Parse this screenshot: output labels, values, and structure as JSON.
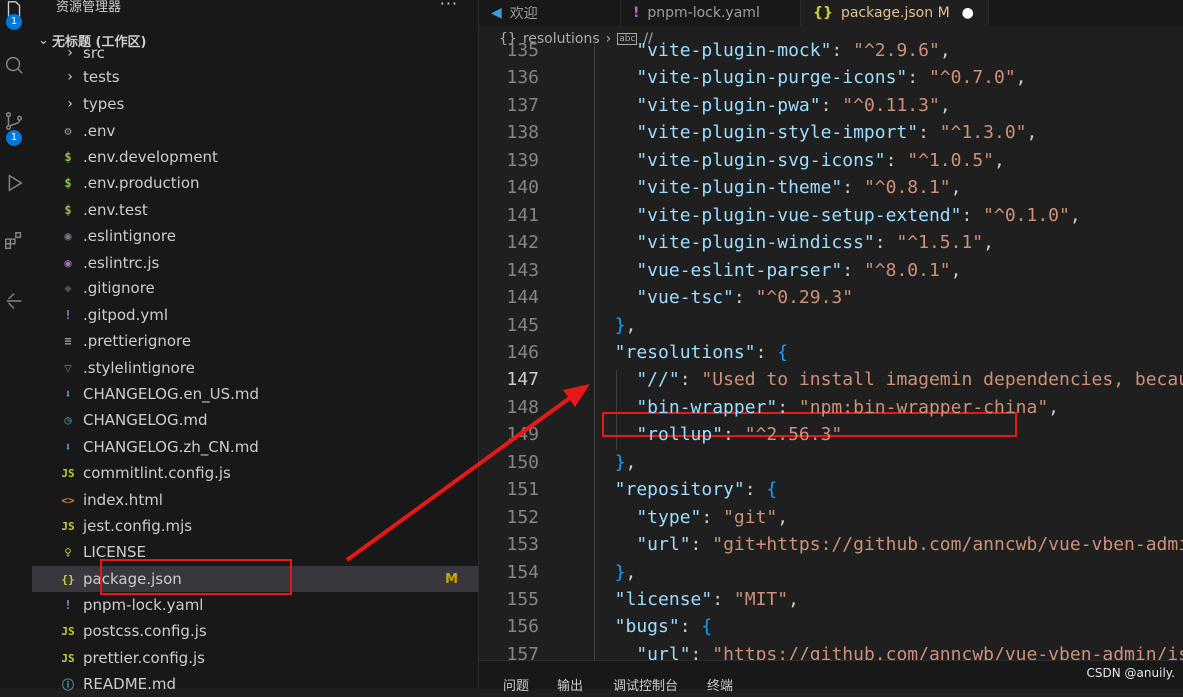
{
  "sidebar": {
    "title": "资源管理器",
    "more": "···",
    "workspace": "无标题 (工作区)"
  },
  "activity_badges": {
    "explorer": "1",
    "scm": "1"
  },
  "tree": [
    {
      "label": "src",
      "icon": "chevron-right-icon",
      "glyph": "›",
      "color": "#cccccc",
      "folder": true
    },
    {
      "label": "tests",
      "icon": "chevron-right-icon",
      "glyph": "›",
      "color": "#cccccc",
      "folder": true
    },
    {
      "label": "types",
      "icon": "chevron-right-icon",
      "glyph": "›",
      "color": "#cccccc",
      "folder": true
    },
    {
      "label": ".env",
      "icon": "gear-icon",
      "glyph": "⚙",
      "color": "#8b9bab"
    },
    {
      "label": ".env.development",
      "icon": "dollar-icon",
      "glyph": "$",
      "color": "#8dc149"
    },
    {
      "label": ".env.production",
      "icon": "dollar-icon",
      "glyph": "$",
      "color": "#8dc149"
    },
    {
      "label": ".env.test",
      "icon": "dollar-icon",
      "glyph": "$",
      "color": "#8dc149"
    },
    {
      "label": ".eslintignore",
      "icon": "eslint-icon",
      "glyph": "◉",
      "color": "#6d8086"
    },
    {
      "label": ".eslintrc.js",
      "icon": "eslint-icon",
      "glyph": "◉",
      "color": "#a074c4"
    },
    {
      "label": ".gitignore",
      "icon": "git-icon",
      "glyph": "◆",
      "color": "#41535b"
    },
    {
      "label": ".gitpod.yml",
      "icon": "exclamation-icon",
      "glyph": "!",
      "color": "#a074c4"
    },
    {
      "label": ".prettierignore",
      "icon": "lines-icon",
      "glyph": "≡",
      "color": "#8b9bab"
    },
    {
      "label": ".stylelintignore",
      "icon": "stylelint-icon",
      "glyph": "▽",
      "color": "#6d8086"
    },
    {
      "label": "CHANGELOG.en_US.md",
      "icon": "download-icon",
      "glyph": "⬇",
      "color": "#519aba"
    },
    {
      "label": "CHANGELOG.md",
      "icon": "clock-icon",
      "glyph": "◷",
      "color": "#519aba"
    },
    {
      "label": "CHANGELOG.zh_CN.md",
      "icon": "download-icon",
      "glyph": "⬇",
      "color": "#519aba"
    },
    {
      "label": "commitlint.config.js",
      "icon": "js-icon",
      "glyph": "JS",
      "color": "#cbcb41"
    },
    {
      "label": "index.html",
      "icon": "html-icon",
      "glyph": "<>",
      "color": "#e37933"
    },
    {
      "label": "jest.config.mjs",
      "icon": "js-icon",
      "glyph": "JS",
      "color": "#cbcb41"
    },
    {
      "label": "LICENSE",
      "icon": "license-icon",
      "glyph": "♀",
      "color": "#cbcb41"
    },
    {
      "label": "package.json",
      "icon": "json-icon",
      "glyph": "{}",
      "color": "#cbcb41",
      "selected": true,
      "badge": "M"
    },
    {
      "label": "pnpm-lock.yaml",
      "icon": "exclamation-icon",
      "glyph": "!",
      "color": "#a074c4"
    },
    {
      "label": "postcss.config.js",
      "icon": "js-icon",
      "glyph": "JS",
      "color": "#cbcb41"
    },
    {
      "label": "prettier.config.js",
      "icon": "js-icon",
      "glyph": "JS",
      "color": "#cbcb41"
    },
    {
      "label": "README.md",
      "icon": "info-icon",
      "glyph": "ⓘ",
      "color": "#519aba"
    }
  ],
  "tabs": [
    {
      "label": "欢迎",
      "icon": "vscode-icon",
      "glyph": "◀",
      "color": "#3e9ad6",
      "active": false
    },
    {
      "label": "pnpm-lock.yaml",
      "icon": "exclamation-icon",
      "glyph": "!",
      "color": "#a074c4",
      "active": false
    },
    {
      "label": "package.json M",
      "icon": "json-icon",
      "glyph": "{}",
      "color": "#cbcb41",
      "active": true,
      "dot": "●"
    }
  ],
  "breadcrumb": {
    "icon": "{}",
    "item1": "resolutions",
    "sep": "›",
    "icon2": "abc",
    "item2": "//"
  },
  "code_lines": [
    {
      "n": "135",
      "parts": [
        [
          "k",
          "    \"vite-plugin-mock\""
        ],
        [
          "p",
          ": "
        ],
        [
          "s",
          "\"^2.9.6\""
        ],
        [
          "p",
          ","
        ]
      ]
    },
    {
      "n": "136",
      "parts": [
        [
          "k",
          "    \"vite-plugin-purge-icons\""
        ],
        [
          "p",
          ": "
        ],
        [
          "s",
          "\"^0.7.0\""
        ],
        [
          "p",
          ","
        ]
      ]
    },
    {
      "n": "137",
      "parts": [
        [
          "k",
          "    \"vite-plugin-pwa\""
        ],
        [
          "p",
          ": "
        ],
        [
          "s",
          "\"^0.11.3\""
        ],
        [
          "p",
          ","
        ]
      ]
    },
    {
      "n": "138",
      "parts": [
        [
          "k",
          "    \"vite-plugin-style-import\""
        ],
        [
          "p",
          ": "
        ],
        [
          "s",
          "\"^1.3.0\""
        ],
        [
          "p",
          ","
        ]
      ]
    },
    {
      "n": "139",
      "parts": [
        [
          "k",
          "    \"vite-plugin-svg-icons\""
        ],
        [
          "p",
          ": "
        ],
        [
          "s",
          "\"^1.0.5\""
        ],
        [
          "p",
          ","
        ]
      ]
    },
    {
      "n": "140",
      "parts": [
        [
          "k",
          "    \"vite-plugin-theme\""
        ],
        [
          "p",
          ": "
        ],
        [
          "s",
          "\"^0.8.1\""
        ],
        [
          "p",
          ","
        ]
      ]
    },
    {
      "n": "141",
      "parts": [
        [
          "k",
          "    \"vite-plugin-vue-setup-extend\""
        ],
        [
          "p",
          ": "
        ],
        [
          "s",
          "\"^0.1.0\""
        ],
        [
          "p",
          ","
        ]
      ]
    },
    {
      "n": "142",
      "parts": [
        [
          "k",
          "    \"vite-plugin-windicss\""
        ],
        [
          "p",
          ": "
        ],
        [
          "s",
          "\"^1.5.1\""
        ],
        [
          "p",
          ","
        ]
      ]
    },
    {
      "n": "143",
      "parts": [
        [
          "k",
          "    \"vue-eslint-parser\""
        ],
        [
          "p",
          ": "
        ],
        [
          "s",
          "\"^8.0.1\""
        ],
        [
          "p",
          ","
        ]
      ]
    },
    {
      "n": "144",
      "parts": [
        [
          "k",
          "    \"vue-tsc\""
        ],
        [
          "p",
          ": "
        ],
        [
          "s",
          "\"^0.29.3\""
        ]
      ]
    },
    {
      "n": "145",
      "parts": [
        [
          "p",
          "  "
        ],
        [
          "b2",
          "}"
        ],
        [
          "p",
          ","
        ]
      ]
    },
    {
      "n": "146",
      "parts": [
        [
          "k",
          "  \"resolutions\""
        ],
        [
          "p",
          ": "
        ],
        [
          "b2",
          "{"
        ]
      ]
    },
    {
      "n": "147",
      "parts": [
        [
          "k",
          "    \"//\""
        ],
        [
          "p",
          ": "
        ],
        [
          "s",
          "\"Used to install imagemin dependencies, becau"
        ]
      ],
      "current": true
    },
    {
      "n": "148",
      "parts": [
        [
          "k",
          "    \"bin-wrapper\""
        ],
        [
          "p",
          ": "
        ],
        [
          "s",
          "\"npm:bin-wrapper-china\""
        ],
        [
          "p",
          ","
        ]
      ]
    },
    {
      "n": "149",
      "parts": [
        [
          "k",
          "    \"rollup\""
        ],
        [
          "p",
          ": "
        ],
        [
          "s",
          "\"^2.56.3\""
        ]
      ]
    },
    {
      "n": "150",
      "parts": [
        [
          "p",
          "  "
        ],
        [
          "b2",
          "}"
        ],
        [
          "p",
          ","
        ]
      ]
    },
    {
      "n": "151",
      "parts": [
        [
          "k",
          "  \"repository\""
        ],
        [
          "p",
          ": "
        ],
        [
          "b2",
          "{"
        ]
      ]
    },
    {
      "n": "152",
      "parts": [
        [
          "k",
          "    \"type\""
        ],
        [
          "p",
          ": "
        ],
        [
          "s",
          "\"git\""
        ],
        [
          "p",
          ","
        ]
      ]
    },
    {
      "n": "153",
      "parts": [
        [
          "k",
          "    \"url\""
        ],
        [
          "p",
          ": "
        ],
        [
          "s",
          "\"git+https://github.com/anncwb/vue-vben-admi"
        ]
      ]
    },
    {
      "n": "154",
      "parts": [
        [
          "p",
          "  "
        ],
        [
          "b2",
          "}"
        ],
        [
          "p",
          ","
        ]
      ]
    },
    {
      "n": "155",
      "parts": [
        [
          "k",
          "  \"license\""
        ],
        [
          "p",
          ": "
        ],
        [
          "s",
          "\"MIT\""
        ],
        [
          "p",
          ","
        ]
      ]
    },
    {
      "n": "156",
      "parts": [
        [
          "k",
          "  \"bugs\""
        ],
        [
          "p",
          ": "
        ],
        [
          "b2",
          "{"
        ]
      ]
    },
    {
      "n": "157",
      "parts": [
        [
          "k",
          "    \"url\""
        ],
        [
          "p",
          ": "
        ],
        [
          "s",
          "\"https://github.com/anncwb/vue-vben-admin/is"
        ]
      ]
    }
  ],
  "panel_tabs": [
    "问题",
    "输出",
    "调试控制台",
    "终端"
  ],
  "watermark": "CSDN @anuily."
}
